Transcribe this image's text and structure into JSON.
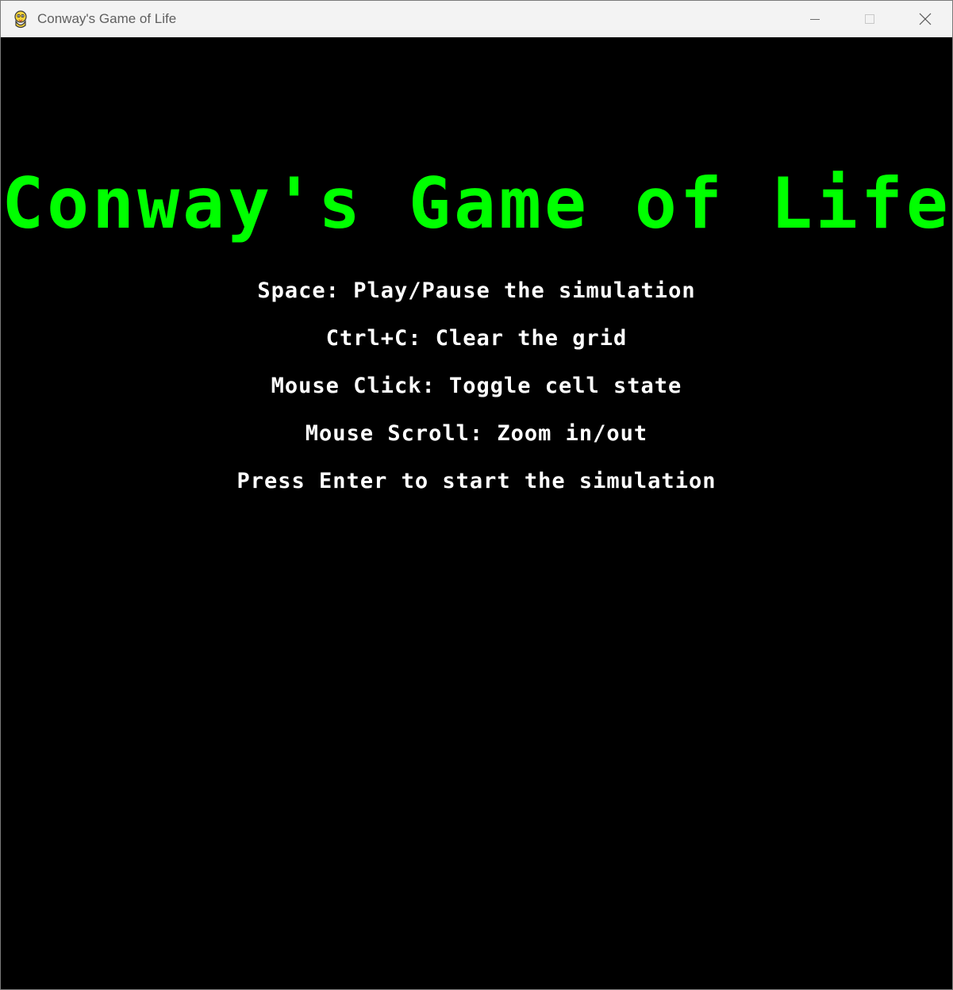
{
  "window": {
    "title": "Conway's Game of Life",
    "app_icon": "pygame-snake-icon",
    "controls": {
      "minimize_icon": "minimize-icon",
      "maximize_icon": "maximize-icon",
      "close_icon": "close-icon"
    }
  },
  "game": {
    "title": "Conway's Game of Life",
    "title_color": "#00ff00",
    "text_color": "#ffffff",
    "background_color": "#000000",
    "instructions": [
      "Space: Play/Pause the simulation",
      "Ctrl+C: Clear the grid",
      "Mouse Click: Toggle cell state",
      "Mouse Scroll: Zoom in/out",
      "Press Enter to start the simulation"
    ]
  }
}
